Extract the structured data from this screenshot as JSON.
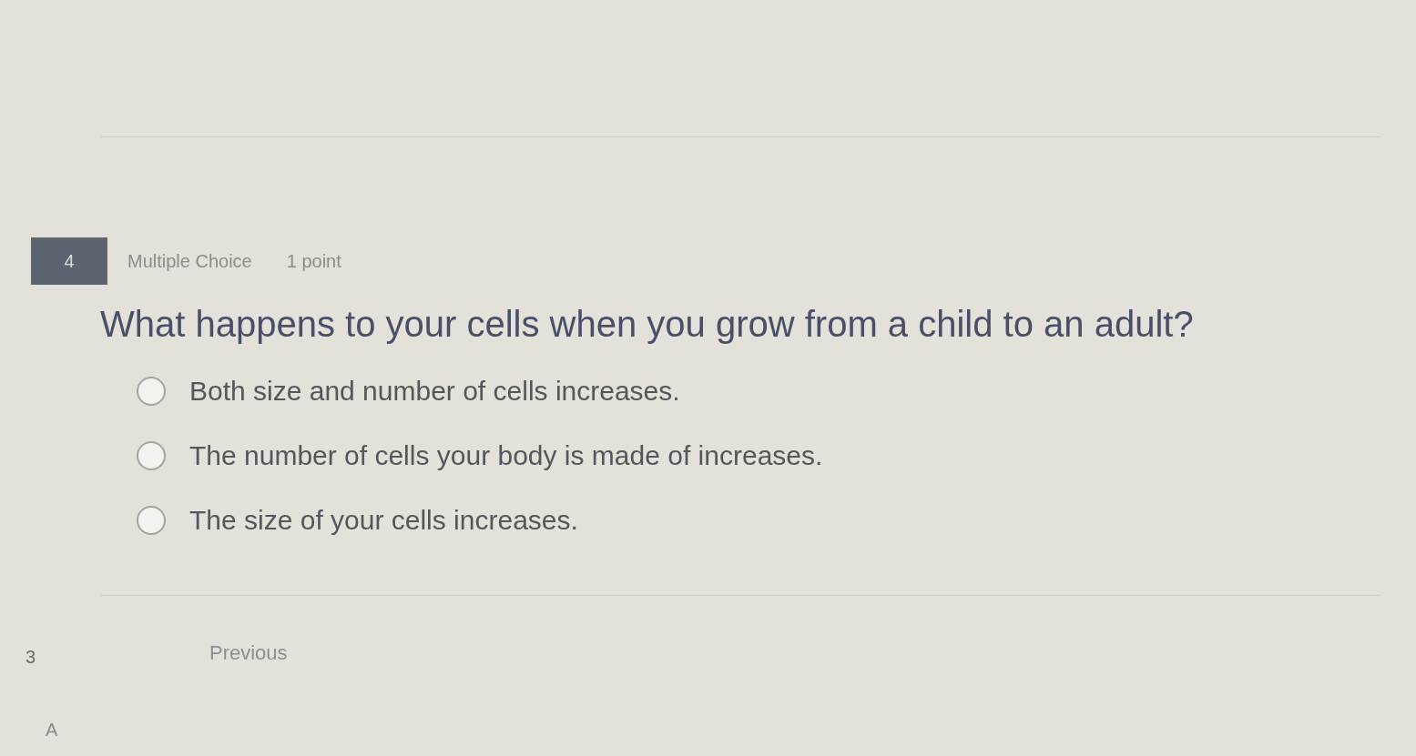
{
  "sidebar": {
    "items": [
      {
        "label": "3"
      },
      {
        "label": "A"
      }
    ]
  },
  "question": {
    "number": "4",
    "type": "Multiple Choice",
    "points": "1 point",
    "text": "What happens to your cells when you grow from a child to an adult?",
    "options": [
      {
        "label": "Both size and number of cells increases.",
        "selected": false
      },
      {
        "label": "The number of cells your body is made of increases.",
        "selected": false
      },
      {
        "label": "The size of your cells increases.",
        "selected": false
      }
    ]
  },
  "navigation": {
    "previous": "Previous"
  }
}
